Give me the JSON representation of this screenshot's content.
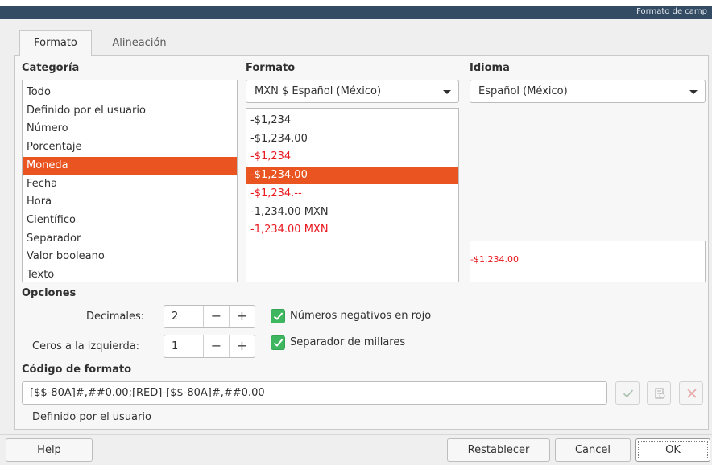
{
  "window": {
    "title": "Formato de camp"
  },
  "tabs": [
    {
      "label": "Formato",
      "active": true
    },
    {
      "label": "Alineación",
      "active": false
    }
  ],
  "categoria": {
    "heading": "Categoría",
    "items": [
      "Todo",
      "Definido por el usuario",
      "Número",
      "Porcentaje",
      "Moneda",
      "Fecha",
      "Hora",
      "Científico",
      "Separador",
      "Valor booleano",
      "Texto"
    ],
    "selected_index": 4
  },
  "formato": {
    "heading": "Formato",
    "combo_value": "MXN  $  Español (México)",
    "items": [
      {
        "text": "-$1,234",
        "red": false
      },
      {
        "text": "-$1,234.00",
        "red": false
      },
      {
        "text": "-$1,234",
        "red": true
      },
      {
        "text": "-$1,234.00",
        "red": true
      },
      {
        "text": "-$1,234.--",
        "red": true
      },
      {
        "text": "-1,234.00 MXN",
        "red": false
      },
      {
        "text": "-1,234.00 MXN",
        "red": true
      }
    ],
    "selected_index": 3
  },
  "idioma": {
    "heading": "Idioma",
    "combo_value": "Español (México)",
    "preview_text": "-$1,234.00"
  },
  "opciones": {
    "heading": "Opciones",
    "decimales_label": "Decimales:",
    "decimales_value": "2",
    "ceros_label": "Ceros a la izquierda:",
    "ceros_value": "1",
    "minus_symbol": "−",
    "plus_symbol": "+",
    "negativos_label": "Números negativos en rojo",
    "negativos_checked": true,
    "millares_label": "Separador de millares",
    "millares_checked": true
  },
  "codigo": {
    "heading": "Código de formato",
    "value": "[$$-80A]#,##0.00;[RED]-[$$-80A]#,##0.00",
    "description": "Definido por el usuario"
  },
  "colors": {
    "accent": "#e95420",
    "negative_red": "#e8191f",
    "check_green": "#3fb760",
    "titlebar": "#334b63"
  },
  "buttons": {
    "help": "Help",
    "reset": "Restablecer",
    "cancel": "Cancel",
    "ok": "OK"
  }
}
